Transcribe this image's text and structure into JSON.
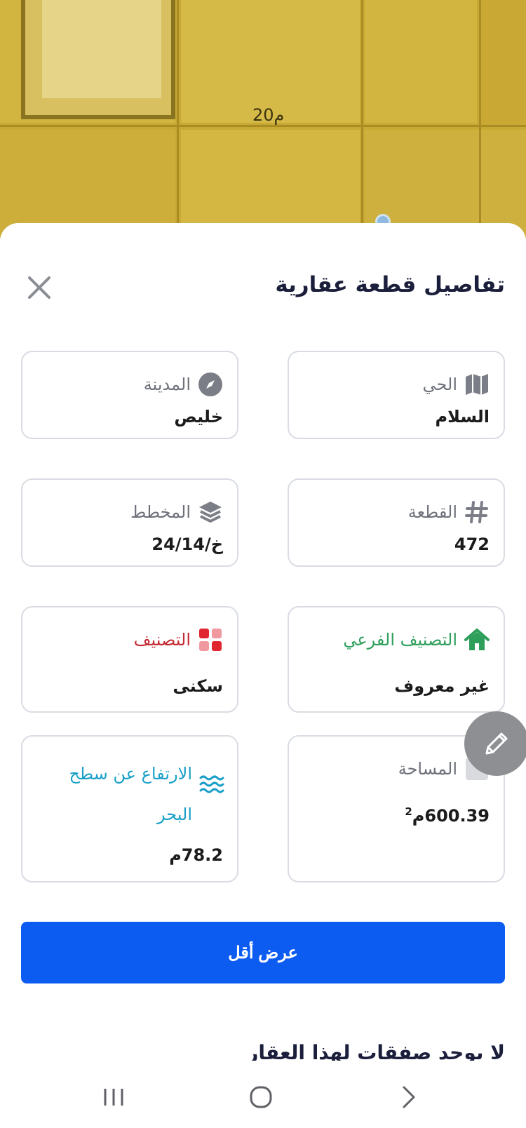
{
  "map": {
    "dimension_label": "20م"
  },
  "sheet": {
    "title": "تفاصيل قطعة عقارية"
  },
  "cards": {
    "district": {
      "label": "الحي",
      "value": "السلام"
    },
    "city": {
      "label": "المدينة",
      "value": "خليص"
    },
    "plot": {
      "label": "القطعة",
      "value": "472"
    },
    "plan": {
      "label": "المخطط",
      "value": "خ/24/14"
    },
    "sub_classification": {
      "label": "التصنيف الفرعي",
      "value": "غير معروف"
    },
    "classification": {
      "label": "التصنيف",
      "value": "سكنى"
    },
    "area": {
      "label": "المساحة",
      "value": "600.39م",
      "unit_sup": "2"
    },
    "elevation": {
      "label": "الارتفاع عن سطح البحر",
      "value": "78.2م"
    }
  },
  "actions": {
    "show_less": "عرض أقل"
  },
  "deals": {
    "empty_text": "لا يوجد صفقات لهذا العقار"
  },
  "colors": {
    "primary": "#0d5cf2",
    "sub_classification": "#2e9e5b",
    "classification": "#c42b35",
    "elevation": "#1aa0c8"
  },
  "icons": {
    "close": "close-icon",
    "district": "map-icon",
    "city": "compass-icon",
    "plot": "hash-icon",
    "plan": "layers-icon",
    "sub_classification": "home-icon",
    "classification": "grid-icon",
    "area": "square-icon",
    "elevation": "waves-icon",
    "edit": "pencil-icon"
  }
}
